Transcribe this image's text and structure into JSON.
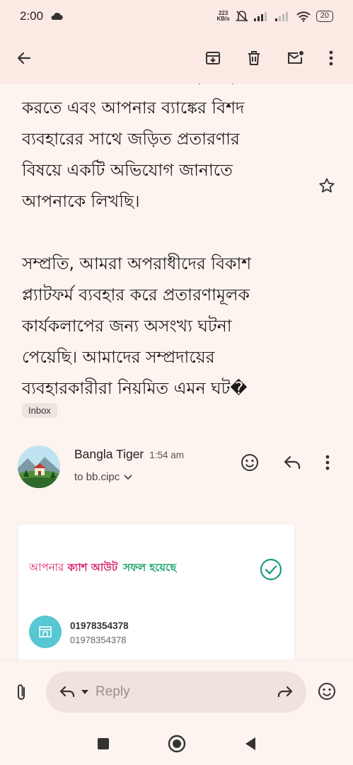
{
  "status_bar": {
    "time": "2:00",
    "net_speed_value": "223",
    "net_speed_unit": "KB/s",
    "battery": "20"
  },
  "toolbar": {
    "back_icon": "arrow-left-icon",
    "archive_icon": "archive-icon",
    "delete_icon": "trash-icon",
    "mark_unread_icon": "mail-unread-icon",
    "more_icon": "more-vert-icon"
  },
  "message": {
    "partial_line": "কারণে যে আমাদের ক্ষতি হয়েছে তার",
    "lines_para1": [
      "করতে এবং আপনার ব্যাঙ্কের বিশদ",
      "ব্যবহারের সাথে জড়িত প্রতারণার",
      "বিষয়ে একটি অভিযোগ জানাতে",
      "আপনাকে লিখছি।"
    ],
    "lines_para2": [
      "সম্প্রতি, আমরা অপরাধীদের বিকাশ",
      "প্ল্যাটফর্ম ব্যবহার করে প্রতারণামূলক",
      "কার্যকলাপের জন্য অসংখ্য ঘটনা",
      "পেয়েছি। আমাদের সম্প্রদায়ের",
      "ব্যবহারকারীরা নিয়মিত এমন ঘট�"
    ],
    "label": "Inbox"
  },
  "sender": {
    "name": "Bangla Tiger",
    "time": "1:54 am",
    "to": "to bb.cipc"
  },
  "card": {
    "title_part1": "আপনার",
    "title_part2": "ক্যাশ আউট",
    "title_part3": "সফল হয়েছে",
    "number1": "01978354378",
    "number2": "01978354378"
  },
  "reply": {
    "placeholder": "Reply"
  },
  "colors": {
    "background": "#fdf3ef",
    "toolbar": "#fbe9e3",
    "card_pink": "#d6216d",
    "card_green": "#1aa36a",
    "check_teal": "#1f9c86"
  }
}
